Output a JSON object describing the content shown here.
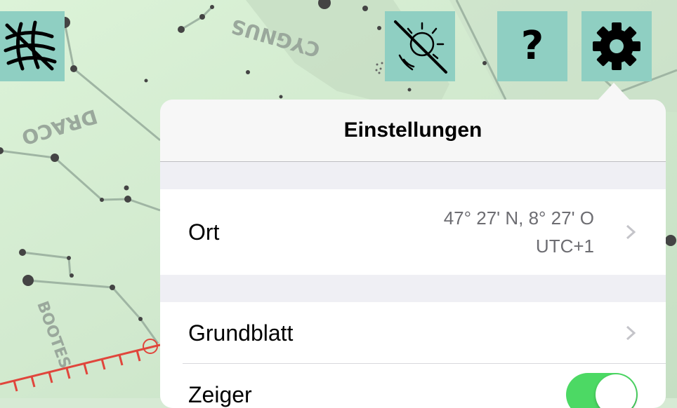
{
  "map": {
    "constellations": [
      "CYGNUS",
      "DRACO",
      "BOOTES"
    ],
    "accent_color": "#e0463c"
  },
  "toolbar": {
    "grid_icon": "grid-icon",
    "daylight_icon": "sun-off-icon",
    "help_label": "?",
    "settings_icon": "gear-icon",
    "button_color": "#8fcfc2"
  },
  "settings": {
    "title": "Einstellungen",
    "location": {
      "label": "Ort",
      "coords": "47° 27' N, 8° 27' O",
      "timezone": "UTC+1"
    },
    "base_sheet": {
      "label": "Grundblatt"
    },
    "pointer": {
      "label": "Zeiger",
      "enabled": true
    }
  }
}
